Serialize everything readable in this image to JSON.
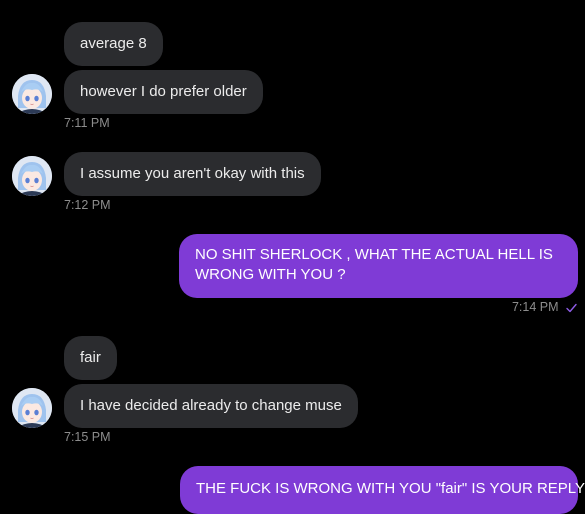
{
  "colors": {
    "background": "#000000",
    "incoming_bubble": "#2b2c2f",
    "outgoing_bubble": "#7f3bd6",
    "timestamp": "#8d8d8d",
    "read_check": "#8e5ce6"
  },
  "messages": [
    {
      "sender": "them",
      "text": "average 8"
    },
    {
      "sender": "them",
      "text": "however I do prefer older",
      "time": "7:11 PM"
    },
    {
      "sender": "them",
      "text": "I assume you aren't okay with this",
      "time": "7:12 PM"
    },
    {
      "sender": "me",
      "text": "NO SHIT SHERLOCK , WHAT THE ACTUAL HELL IS WRONG WITH YOU ?",
      "time": "7:14 PM",
      "read_icon": "checkmark-icon"
    },
    {
      "sender": "them",
      "text": "fair"
    },
    {
      "sender": "them",
      "text": "I have decided already to change muse",
      "time": "7:15 PM"
    },
    {
      "sender": "me",
      "text": "THE FUCK IS WRONG WITH YOU \"fair\" IS YOUR REPLY?"
    }
  ]
}
